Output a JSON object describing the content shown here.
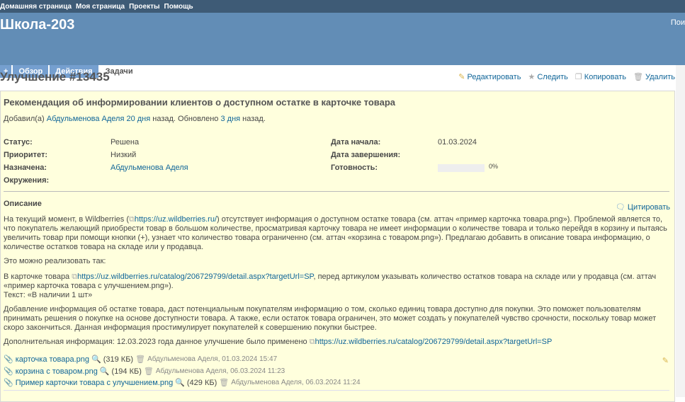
{
  "top_menu": [
    "Домашняя страница",
    "Моя страница",
    "Проекты",
    "Помощь"
  ],
  "project_title": "Школа-203",
  "search_label": "Пои",
  "tabs": [
    "+",
    "Обзор",
    "Действия",
    "Задачи"
  ],
  "page_title": "Улучшение #13435",
  "actions": {
    "edit": "Редактировать",
    "watch": "Следить",
    "copy": "Копировать",
    "delete": "Удалить"
  },
  "issue": {
    "subject": "Рекомендация об информировании клиентов о доступном остатке в карточке товара",
    "author_prefix": "Добавил(а)",
    "author": "Абдульменова Аделя",
    "created": "20 дня",
    "mid": "назад. Обновлено",
    "updated": "3 дня",
    "suffix": "назад.",
    "fields": {
      "status_label": "Статус:",
      "status": "Решена",
      "priority_label": "Приоритет:",
      "priority": "Низкий",
      "assigned_label": "Назначена:",
      "assigned": "Абдульменова Аделя",
      "env_label": "Окружения:",
      "start_label": "Дата начала:",
      "start": "01.03.2024",
      "due_label": "Дата завершения:",
      "done_label": "Готовность:",
      "done": "0%",
      "done_value": 0
    },
    "description_label": "Описание",
    "quote": "Цитировать",
    "p1a": "На текущий момент, в Wildberries (",
    "p1link": "https://uz.wildberries.ru/",
    "p1b": ") отсутствует информация о доступном остатке товара (см. аттач «пример карточка товара.png»). Проблемой является то, что покупатель желающий приобрести товар в большом количестве, просматривая карточку товара не имеет информации о количестве товара и только перейдя в корзину и пытаясь увеличить товар при помощи кнопки (+), узнает что количество товара ограниченно (см. аттач «корзина с товаром.png»). Предлагаю добавить в описание товара информацию, о количестве остатков товара на складе или у продавца.",
    "p2": "Это можно реализовать так:",
    "p3a": "В карточке товара ",
    "p3link": "https://uz.wildberries.ru/catalog/206729799/detail.aspx?targetUrl=SP",
    "p3b": ", перед артикулом указывать количество остатков товара на складе или у продавца (см. аттач «пример карточка товара с улучшением.png»).",
    "p3c": "Текст: «В наличии 1 шт»",
    "p4": "Добавление информация об остатке товара, даст потенциальным покупателям информацию о том, сколько единиц товара доступно для покупки. Это поможет пользователям принимать решения о покупке на основе доступности товара. А также, если остаток товара ограничен, это может создать у покупателей чувство срочности, поскольку товар может скоро закончиться. Данная информация простимулирует покупателей к совершению покупки быстрее.",
    "p5a": "Дополнительная информация: 12.03.2023 года данное улучшение было применено ",
    "p5link": "https://uz.wildberries.ru/catalog/206729799/detail.aspx?targetUrl=SP",
    "attachments": [
      {
        "name": "карточка товара.png",
        "size": "(319 КБ)",
        "meta": "Абдульменова Аделя, 01.03.2024 15:47"
      },
      {
        "name": "корзина с товаром.png",
        "size": "(194 КБ)",
        "meta": "Абдульменова Аделя, 06.03.2024 11:23"
      },
      {
        "name": "Пример карточки товара с улучшением.png",
        "size": "(429 КБ)",
        "meta": "Абдульменова Аделя, 06.03.2024 11:24"
      }
    ]
  }
}
